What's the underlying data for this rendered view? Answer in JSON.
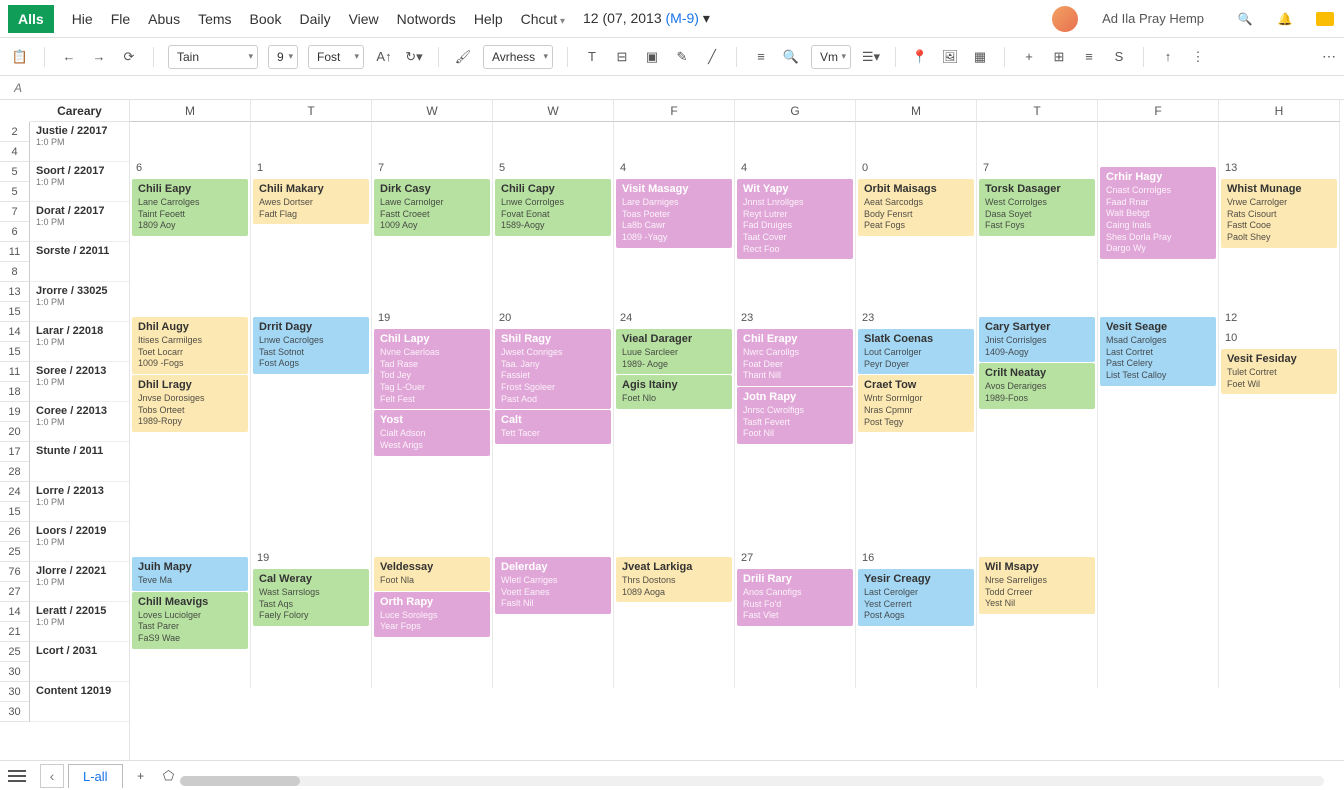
{
  "menubar": {
    "logo": "Alls",
    "items": [
      "Hie",
      "Fle",
      "Abus",
      "Tems",
      "Book",
      "Daily",
      "View",
      "Notwords",
      "Help",
      "Chcut"
    ],
    "date_text": "12 (07, 2013 ",
    "date_link": "(M-9)",
    "user_name": "Ad Ila Pray Hemp"
  },
  "toolbar": {
    "font_select": "Tain",
    "size_select": "9",
    "fontname_select": "Fost",
    "align_select": "Avrhess",
    "vm_select": "Vm"
  },
  "namebox": "A",
  "col_headers": [
    "M",
    "T",
    "W",
    "W",
    "F",
    "G",
    "M",
    "T",
    "F",
    "H"
  ],
  "row_headers": [
    "2",
    "4",
    "5",
    "5",
    "7",
    "6",
    "11",
    "8",
    "13",
    "15",
    "14",
    "15",
    "11",
    "18",
    "19",
    "20",
    "17",
    "28",
    "24",
    "15",
    "26",
    "25",
    "76",
    "27",
    "14",
    "21",
    "25",
    "30",
    "30",
    "30"
  ],
  "sidebar": {
    "header": "Careary",
    "rows": [
      {
        "t": "Justie / 22017",
        "s": "1:0 PM"
      },
      {
        "t": "Soort / 22017",
        "s": "1:0 PM"
      },
      {
        "t": "Dorat / 22017",
        "s": "1:0 PM"
      },
      {
        "t": "Sorste / 22011",
        "s": ""
      },
      {
        "t": "Jrorre / 33025",
        "s": "1:0 PM"
      },
      {
        "t": "Larar / 22018",
        "s": "1:0 PM"
      },
      {
        "t": "Soree / 22013",
        "s": "1:0 PM"
      },
      {
        "t": "Coree / 22013",
        "s": "1:0 PM"
      },
      {
        "t": "Stunte / 2011",
        "s": ""
      },
      {
        "t": "Lorre / 22013",
        "s": "1:0 PM"
      },
      {
        "t": "Loors / 22019",
        "s": "1:0 PM"
      },
      {
        "t": "Jlorre / 22021",
        "s": "1:0 PM"
      },
      {
        "t": "Leratt / 22015",
        "s": "1:0 PM"
      },
      {
        "t": "Lcort / 2031",
        "s": ""
      },
      {
        "t": "Content 12019",
        "s": ""
      }
    ]
  },
  "calendar": {
    "week1": {
      "days": [
        "6",
        "1",
        "7",
        "5",
        "4",
        "4",
        "0",
        "7",
        "",
        "13"
      ],
      "cards": [
        {
          "col": 0,
          "cls": "c-green",
          "title": "Chili Eapy",
          "lines": [
            "Lane Carrolges",
            "Taint Feoett",
            "1809 Aoy"
          ]
        },
        {
          "col": 1,
          "cls": "c-yellow",
          "title": "Chili Makary",
          "lines": [
            "Awes Dortser",
            "Fadt Flag"
          ]
        },
        {
          "col": 2,
          "cls": "c-green",
          "title": "Dirk Casy",
          "lines": [
            "Lawe Carnolger",
            "Fastt Croeet",
            "1009 Aoy"
          ]
        },
        {
          "col": 3,
          "cls": "c-green",
          "title": "Chili Capy",
          "lines": [
            "Lnwe Corrolges",
            "Fovat Eonat",
            "1589-Aogy"
          ]
        },
        {
          "col": 4,
          "cls": "c-pink",
          "title": "Visit Masagy",
          "lines": [
            "Lare Darniges",
            "Toas Poeter",
            "La8b Cawr",
            "1089 -Yagy"
          ]
        },
        {
          "col": 5,
          "cls": "c-pink",
          "title": "Wit Yapy",
          "lines": [
            "Jnnst Lnrollges",
            "Reyt Lutrer",
            "Fad Druiges",
            "Taat Cover",
            "Rect Foo"
          ]
        },
        {
          "col": 6,
          "cls": "c-yellow",
          "title": "Orbit Maisags",
          "lines": [
            "Aeat Sarcodgs",
            "Body Fensrt",
            "Peat Fogs"
          ]
        },
        {
          "col": 7,
          "cls": "c-green",
          "title": "Torsk Dasager",
          "lines": [
            "West Corrolges",
            "Dasa Soyet",
            "Fast Foys"
          ]
        },
        {
          "col": 8,
          "cls": "c-pink",
          "title": "Crhir Hagy",
          "lines": [
            "Cnast Corrolges",
            "Faad Rnar",
            "Walt Bebgt",
            "Caing Inals",
            "Shes Dorla Pray",
            "Dargo Wy"
          ]
        },
        {
          "col": 9,
          "cls": "c-yellow",
          "title": "Whist Munage",
          "lines": [
            "Vrwe Carrolger",
            "Rats Cisourt",
            "Fastt Cooe",
            "Paolt Shey"
          ]
        }
      ]
    },
    "week2": {
      "days": [
        "",
        "",
        "19",
        "20",
        "24",
        "23",
        "23",
        "",
        "",
        "12"
      ],
      "cards": [
        {
          "col": 0,
          "cls": "c-yellow",
          "title": "Dhil Augy",
          "lines": [
            "Itises Carmilges",
            "Toet Locarr",
            "1009 -Fogs"
          ]
        },
        {
          "col": 0,
          "cls": "c-yellow",
          "title": "Dhil Lragy",
          "lines": [
            "Jnvse Dorosiges",
            "Tobs Orteet",
            "1989-Ropy"
          ]
        },
        {
          "col": 1,
          "cls": "c-blue",
          "title": "Drrit Dagy",
          "lines": [
            "Lnwe Cacrolges",
            "Tast Sotnot",
            "Fost Aogs"
          ]
        },
        {
          "col": 2,
          "cls": "c-pink",
          "title": "Chil Lapy",
          "lines": [
            "Nvne Caerloas",
            "Tad Rase",
            "Tod Jey",
            "Tag L-Ouer",
            "Felt Fest"
          ]
        },
        {
          "col": 2,
          "cls": "c-pink",
          "title": "Yost",
          "lines": [
            "Cialt Adson",
            "West Arigs"
          ]
        },
        {
          "col": 3,
          "cls": "c-pink",
          "title": "Shil Ragy",
          "lines": [
            "Jwset Conriges",
            "Taa. Jany",
            "Fassiet",
            "Frost Sgoleer",
            "Past Aod"
          ]
        },
        {
          "col": 3,
          "cls": "c-pink",
          "title": "Calt",
          "lines": [
            "Tett Tacer"
          ]
        },
        {
          "col": 4,
          "cls": "c-green",
          "title": "Vieal Darager",
          "lines": [
            "Luue Sarcleer",
            "1989- Aoge"
          ]
        },
        {
          "col": 4,
          "cls": "c-green",
          "title": "Agis Itainy",
          "lines": [
            "Foet Nlo"
          ]
        },
        {
          "col": 5,
          "cls": "c-pink",
          "title": "Chil Erapy",
          "lines": [
            "Nwrc Carollgs",
            "Foat Deer",
            "Thant Nill"
          ]
        },
        {
          "col": 5,
          "cls": "c-pink",
          "title": "Jotn Rapy",
          "lines": [
            "Jnrsc Cwrolfigs",
            "Tasft Fevert",
            "Foot Nil"
          ]
        },
        {
          "col": 6,
          "cls": "c-blue",
          "title": "Slatk Coenas",
          "lines": [
            "Lout Carrolger",
            "Peyr Doyer"
          ]
        },
        {
          "col": 6,
          "cls": "c-yellow",
          "title": "Craet Tow",
          "lines": [
            "Wntr Sorrnlgor",
            "Nras Cpmnr",
            "Post Tegy"
          ]
        },
        {
          "col": 7,
          "cls": "c-blue",
          "title": "Cary Sartyer",
          "lines": [
            "Jnist Corrislges",
            "1409-Aogy"
          ]
        },
        {
          "col": 7,
          "cls": "c-green",
          "title": "Crilt Neatay",
          "lines": [
            "Avos Derariges",
            "1989-Foos"
          ]
        },
        {
          "col": 8,
          "cls": "c-blue",
          "title": "Vesit Seage",
          "lines": [
            "Msad Carolges",
            "Last Cortret",
            "Past Celery",
            "List Test Calloy"
          ]
        },
        {
          "col": 9,
          "cls": "c-yellow",
          "title": "Vesit Fesiday",
          "lines": [
            "Tulet Cortret",
            "Foet Wil"
          ],
          "pre": "10"
        }
      ]
    },
    "week3": {
      "days": [
        "",
        "19",
        "",
        "",
        "",
        "27",
        "16",
        "",
        ""
      ],
      "cards": [
        {
          "col": 0,
          "cls": "c-blue",
          "title": "Juih Mapy",
          "lines": [
            "Teve Ma"
          ]
        },
        {
          "col": 0,
          "cls": "c-green",
          "title": "Chill Meavigs",
          "lines": [
            "Loves Luciolger",
            "Tast Parer",
            "FaS9 Wae"
          ]
        },
        {
          "col": 1,
          "cls": "c-green",
          "title": "Cal Weray",
          "lines": [
            "Wast Sarrslogs",
            "Tast Aqs",
            "Faely Folory"
          ]
        },
        {
          "col": 2,
          "cls": "c-yellow",
          "title": "Veldessay",
          "lines": [
            "Foot Nla"
          ]
        },
        {
          "col": 2,
          "cls": "c-pink",
          "title": "Orth Rapy",
          "lines": [
            "Luce Sorolegs",
            "Year Fops"
          ]
        },
        {
          "col": 3,
          "cls": "c-pink",
          "title": "Delerday",
          "lines": [
            "Wletl Carriges",
            "Voett Eanes",
            "Faslt Nil"
          ]
        },
        {
          "col": 4,
          "cls": "c-yellow",
          "title": "Jveat Larkiga",
          "lines": [
            "Thrs Dostons",
            "1089 Aoga"
          ]
        },
        {
          "col": 5,
          "cls": "c-pink",
          "title": "Drili Rary",
          "lines": [
            "Anos Canofigs",
            "Rust Fo'd",
            "Fast Vlet"
          ]
        },
        {
          "col": 6,
          "cls": "c-blue",
          "title": "Yesir Creagy",
          "lines": [
            "Last Cerolger",
            "Yest Cerrert",
            "Post Aogs"
          ]
        },
        {
          "col": 7,
          "cls": "c-yellow",
          "title": "Wil Msapy",
          "lines": [
            "Nrse Sarreliges",
            "Todd Crreer",
            "Yest Nil"
          ]
        }
      ]
    }
  },
  "sheet_tab": "L-all"
}
